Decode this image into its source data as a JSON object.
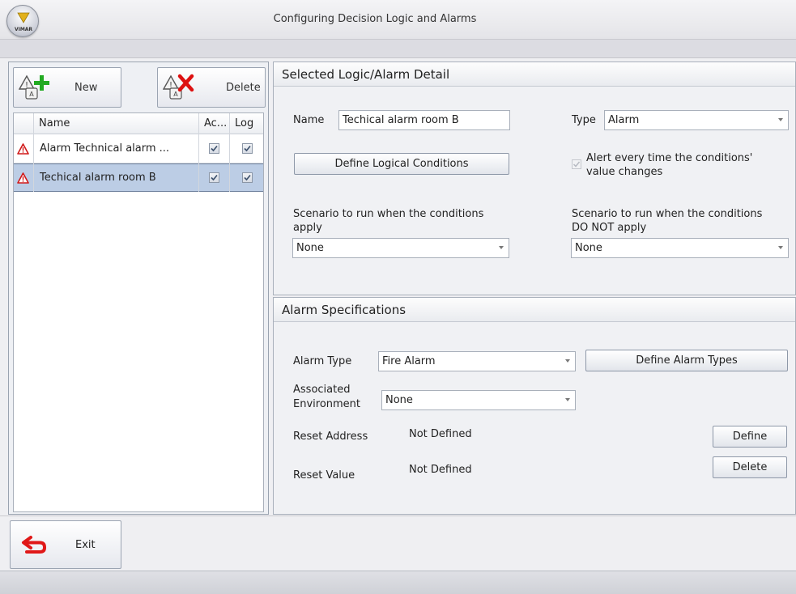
{
  "window": {
    "title": "Configuring Decision Logic and Alarms",
    "logo_text": "VIMAR"
  },
  "toolbar": {
    "new_label": "New",
    "delete_label": "Delete"
  },
  "list": {
    "columns": [
      "Name",
      "Ac...",
      "Log"
    ],
    "rows": [
      {
        "name": "Alarm Technical alarm ...",
        "active": true,
        "log": true,
        "selected": false
      },
      {
        "name": "Techical alarm room B",
        "active": true,
        "log": true,
        "selected": true
      }
    ]
  },
  "detail": {
    "header": "Selected Logic/Alarm Detail",
    "name_label": "Name",
    "name_value": "Techical alarm room B",
    "type_label": "Type",
    "type_value": "Alarm",
    "define_conditions_label": "Define Logical Conditions",
    "alert_line1": "Alert every time the conditions'",
    "alert_line2": "value changes",
    "alert_checked": true,
    "scenario_apply_line1": "Scenario to run when the conditions",
    "scenario_apply_line2": "apply",
    "scenario_apply_value": "None",
    "scenario_not_apply_line1": "Scenario to run when the conditions",
    "scenario_not_apply_line2": "DO NOT apply",
    "scenario_not_apply_value": "None"
  },
  "alarm": {
    "header": "Alarm Specifications",
    "type_label": "Alarm Type",
    "type_value": "Fire Alarm",
    "define_types_label": "Define Alarm Types",
    "env_label_line1": "Associated",
    "env_label_line2": "Environment",
    "env_value": "None",
    "reset_address_label": "Reset Address",
    "reset_address_value": "Not Defined",
    "define_label": "Define",
    "reset_value_label": "Reset Value",
    "reset_value_value": "Not Defined",
    "delete_label": "Delete"
  },
  "footer": {
    "exit_label": "Exit"
  },
  "colors": {
    "accent_green": "#22aa22",
    "delete_red": "#dd1111",
    "warning_red": "#d01818",
    "selection": "#bccde5"
  }
}
